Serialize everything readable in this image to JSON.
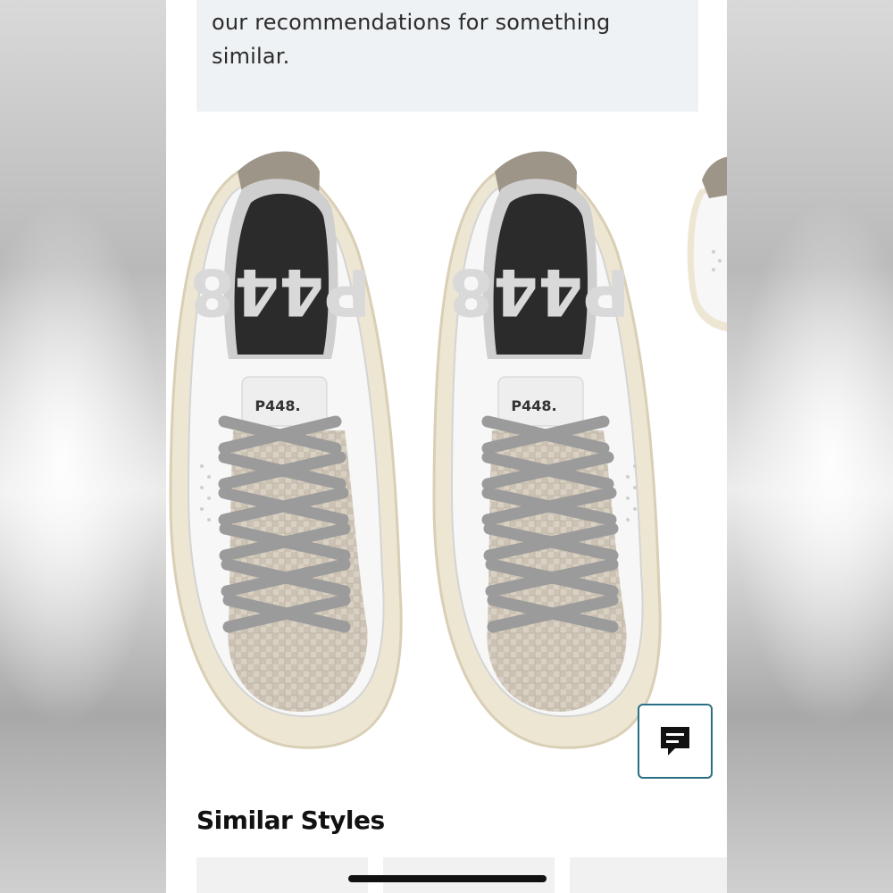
{
  "notice": {
    "line1": "our recommendations for something",
    "line2": "similar."
  },
  "product_image": {
    "tongue_label_left": "P448.",
    "tongue_label_right": "P448.",
    "insole_text_left": "P448",
    "insole_text_right": "P448"
  },
  "chat": {
    "icon": "chat-bubble-icon"
  },
  "similar": {
    "title": "Similar Styles"
  },
  "colors": {
    "notice_bg": "#eef2f5",
    "chat_border": "#2a6f83",
    "text": "#111111"
  }
}
